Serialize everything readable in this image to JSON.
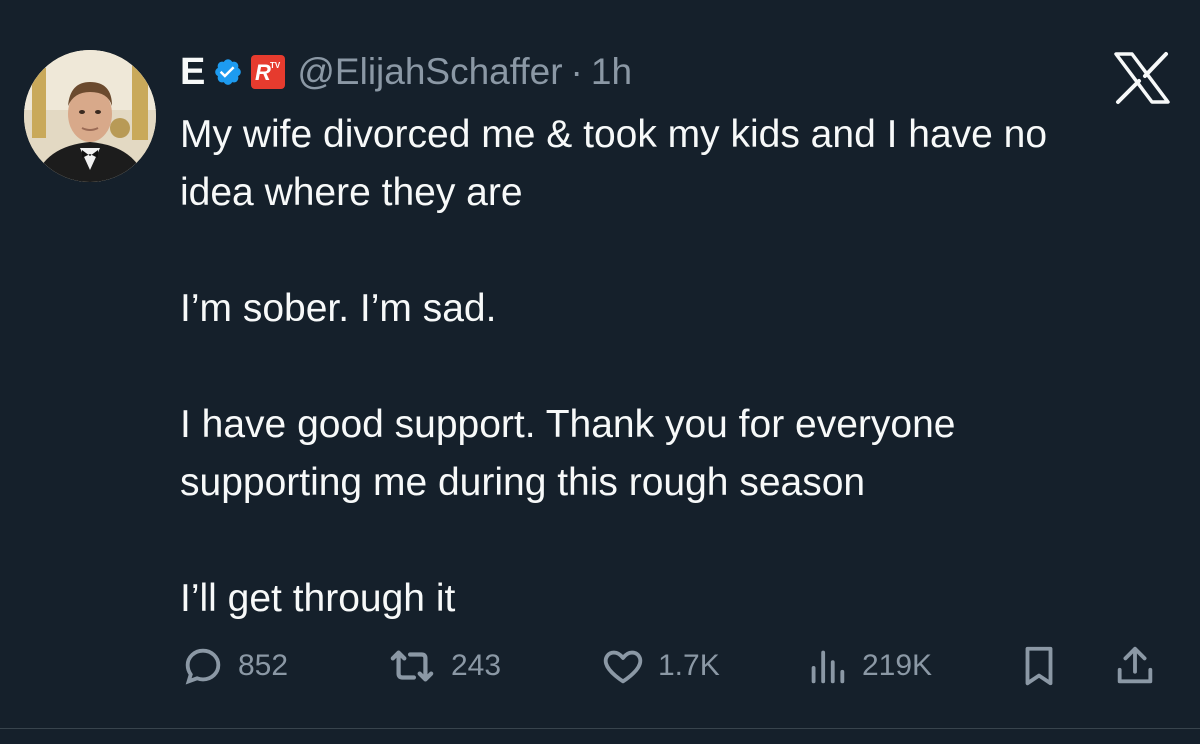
{
  "tweet": {
    "display_name": "E",
    "handle": "@ElijahSchaffer",
    "separator": "·",
    "time": "1h",
    "affiliate_badge": "RTV",
    "body": {
      "p1_line1": "My wife divorced me & took my kids and I have no",
      "p1_line2": "idea where they are",
      "p2": "I’m sober. I’m sad.",
      "p3_line1": "I have good support. Thank you for everyone",
      "p3_line2": "supporting me during this rough season",
      "p4": "I’ll get through it"
    },
    "stats": {
      "replies": "852",
      "retweets": "243",
      "likes": "1.7K",
      "views": "219K"
    }
  },
  "icons": {
    "verified": "verified-badge-icon",
    "logo": "x-logo-icon",
    "reply": "reply-icon",
    "retweet": "retweet-icon",
    "like": "heart-icon",
    "views": "views-icon",
    "bookmark": "bookmark-icon",
    "share": "share-icon"
  },
  "colors": {
    "background": "#15202b",
    "text": "#f7f9f9",
    "secondary": "#8b98a5",
    "verified": "#1d9bf0",
    "affiliate": "#e63b2e"
  }
}
